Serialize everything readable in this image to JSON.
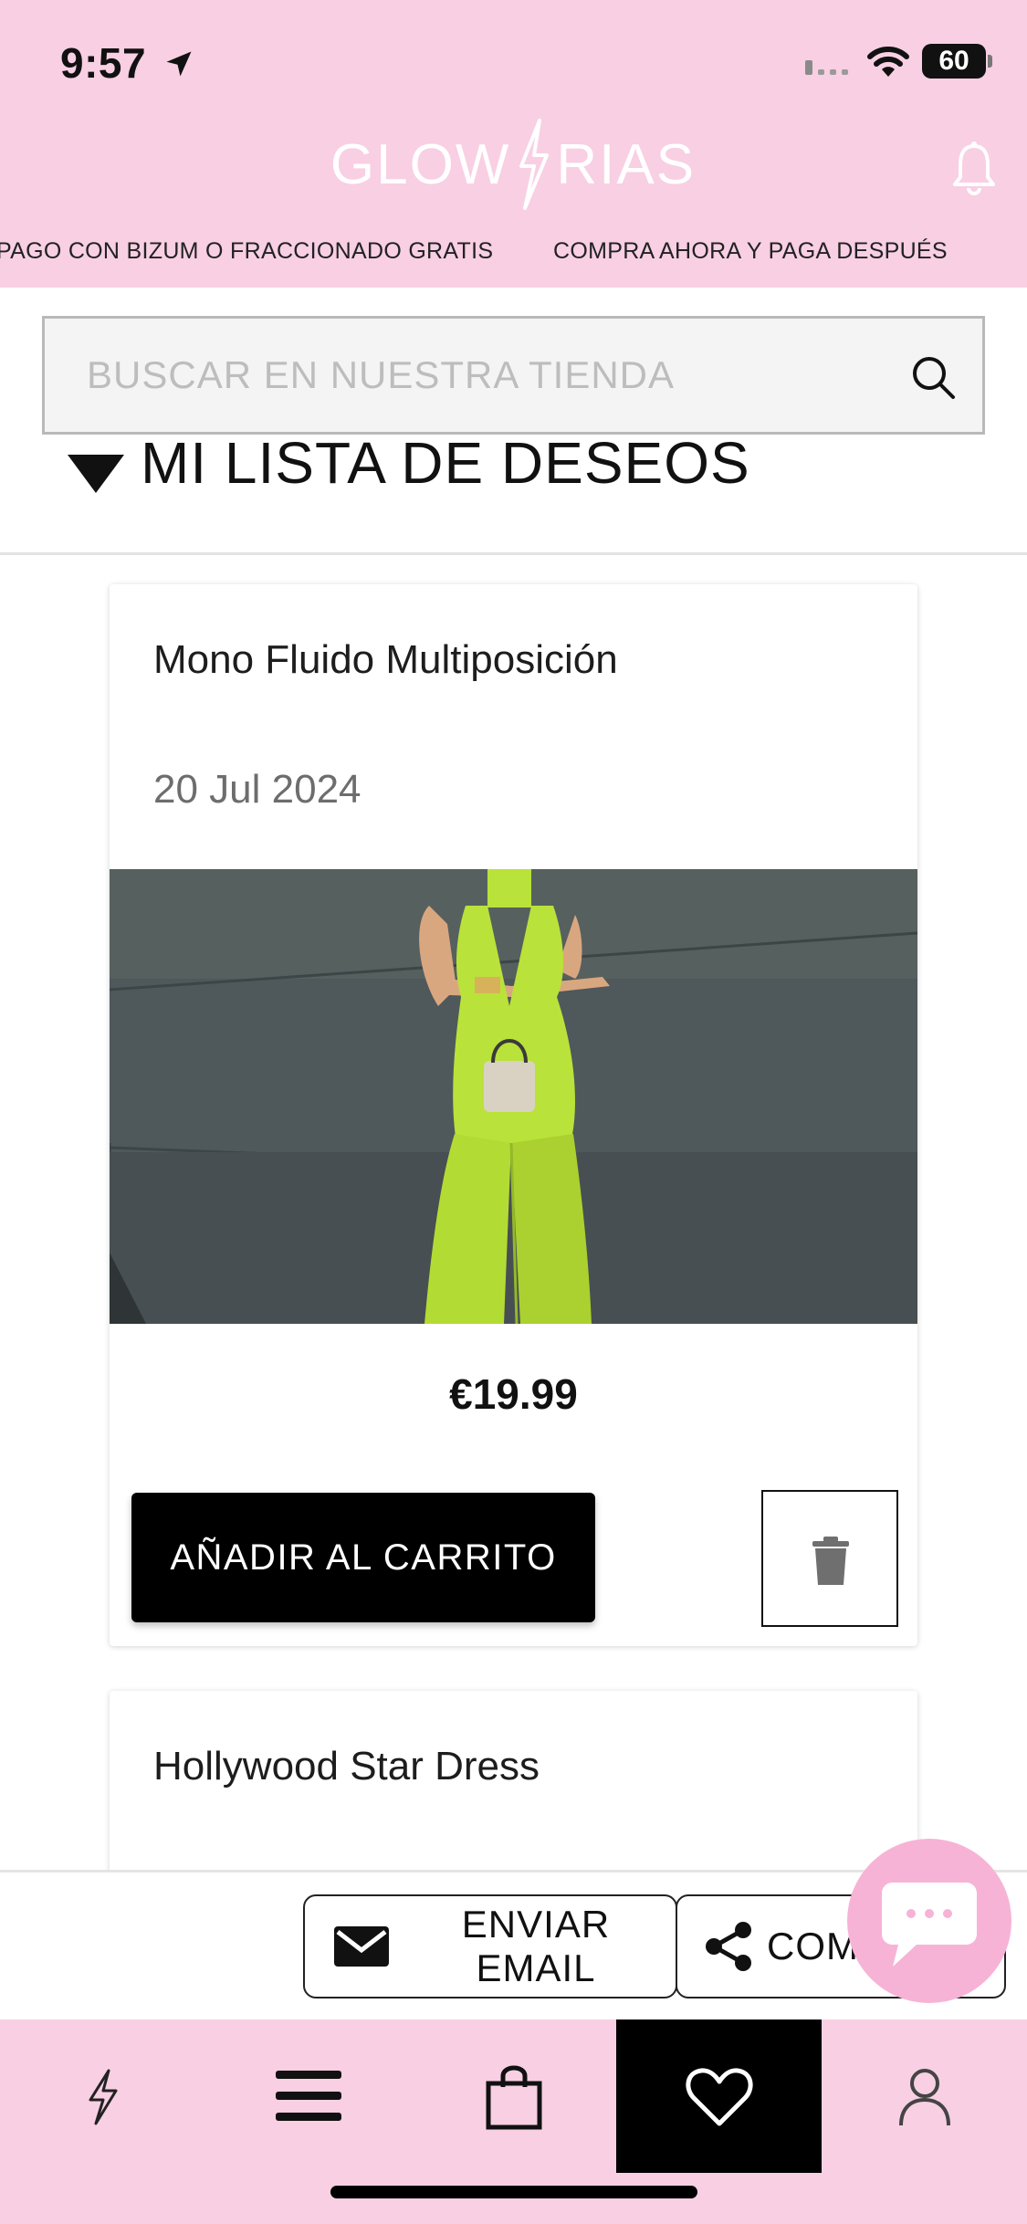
{
  "status_bar": {
    "time": "9:57",
    "battery": "60"
  },
  "header": {
    "logo_left": "GLOW",
    "logo_right": "RIAS",
    "logo_color": "#ffffff",
    "background": "#f8cfe3"
  },
  "marquee": {
    "items": [
      "PAGO CON BIZUM O FRACCIONADO GRATIS",
      "COMPRA AHORA Y PAGA DESPUÉS"
    ]
  },
  "search": {
    "placeholder": "BUSCAR EN NUESTRA TIENDA"
  },
  "wishlist": {
    "title": "MI LISTA DE DESEOS",
    "items": [
      {
        "name": "Mono Fluido Multiposición",
        "date": "20 Jul 2024",
        "price": "€19.99",
        "add_label": "AÑADIR AL CARRITO"
      },
      {
        "name": "Hollywood Star Dress"
      }
    ]
  },
  "share_bar": {
    "email_label": "ENVIAR EMAIL",
    "share_label": "COMPARTIR"
  },
  "bottom_nav": {
    "items": [
      "bolt-icon",
      "menu-icon",
      "bag-icon",
      "heart-icon",
      "user-icon"
    ],
    "active": "heart-icon"
  },
  "colors": {
    "accent_pink": "#f8cfe3",
    "chat_pink": "#f7b3d6",
    "jumpsuit_green": "#b9e23a"
  }
}
